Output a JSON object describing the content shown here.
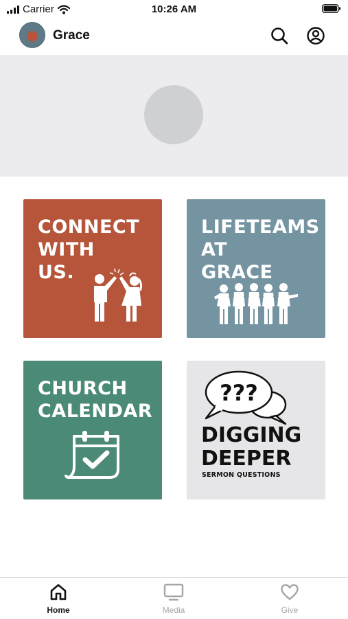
{
  "status_bar": {
    "carrier": "Carrier",
    "time": "10:26 AM",
    "icons": [
      "signal-icon",
      "wifi-icon",
      "battery-icon"
    ]
  },
  "header": {
    "title": "Grace",
    "icons": [
      "search-icon",
      "profile-icon"
    ]
  },
  "tiles": [
    {
      "title": "CONNECT\nWITH\nUS.",
      "art": "high-five-icon",
      "color": "#b6553a"
    },
    {
      "title": "LIFETEAMS\nAT\nGRACE",
      "art": "group-icon",
      "color": "#7494a2"
    },
    {
      "title": "CHURCH\nCALENDAR",
      "art": "calendar-check-icon",
      "color": "#4b8a76"
    },
    {
      "title": "DIGGING\nDEEPER",
      "subtitle": "SERMON QUESTIONS",
      "art": "speech-bubbles-icon",
      "color": "#e6e6e8"
    }
  ],
  "speech_bubble_text": "???",
  "tab_bar": {
    "active": "Home",
    "tabs": [
      {
        "label": "Home",
        "icon": "home-icon"
      },
      {
        "label": "Media",
        "icon": "monitor-icon"
      },
      {
        "label": "Give",
        "icon": "heart-icon"
      }
    ]
  }
}
